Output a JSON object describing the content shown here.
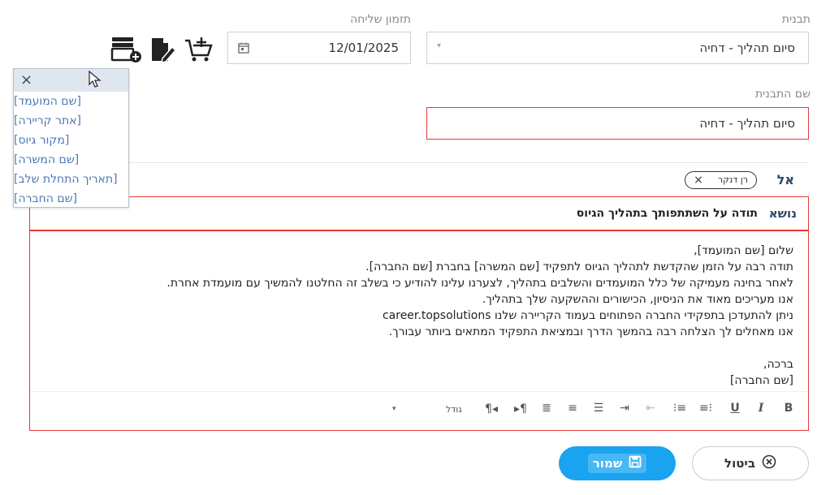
{
  "form": {
    "template_label": "תבנית",
    "template_value": "סיום תהליך - דחיה",
    "send_time_label": "תזמון שליחה",
    "send_time_value": "12/01/2025",
    "template_name_label": "שם התבנית",
    "template_name_value": "סיום תהליך - דחיה"
  },
  "toolbar_icons": [
    "database-add-icon",
    "document-edit-icon",
    "cart-add-icon"
  ],
  "placeholders": {
    "close_glyph": "×",
    "items": [
      "[שם המועמד]",
      "[אתר קריירה]",
      "[מקור גיוס]",
      "[שם המשרה]",
      "[תאריך התחלת שלב]",
      "[שם החברה]"
    ]
  },
  "recipients": {
    "to_label": "אל",
    "chip_name": "רן דנקר",
    "chip_remove": "×"
  },
  "subject": {
    "label": "נושא",
    "value": "תודה על השתתפותך בתהליך הגיוס"
  },
  "body": {
    "lines": [
      "שלום [שם המועמד],",
      "תודה רבה על הזמן שהקדשת לתהליך הגיוס לתפקיד [שם המשרה] בחברת [שם החברה].",
      "לאחר בחינה מעמיקה של כלל המועמדים והשלבים בתהליך, לצערנו עלינו להודיע כי בשלב זה החלטנו להמשיך עם מועמדת אחרת.",
      "אנו מעריכים מאוד את הניסיון, הכישורים וההשקעה שלך בתהליך.",
      "ניתן להתעדכן בתפקידי החברה הפתוחים בעמוד הקריירה שלנו career.topsolutions",
      "אנו מאחלים לך הצלחה רבה בהמשך הדרך ובמציאת התפקיד המתאים ביותר עבורך.",
      "",
      "ברכה,",
      "[שם החברה]"
    ]
  },
  "editor_toolbar": {
    "bold": "B",
    "italic": "I",
    "underline": "U",
    "size_label": "גודל",
    "size_caret": "▾"
  },
  "actions": {
    "save_label": "שמור",
    "cancel_label": "ביטול"
  },
  "colors": {
    "accent": "#1aa3f0",
    "error_border": "#e53935",
    "link": "#4a78b5"
  }
}
